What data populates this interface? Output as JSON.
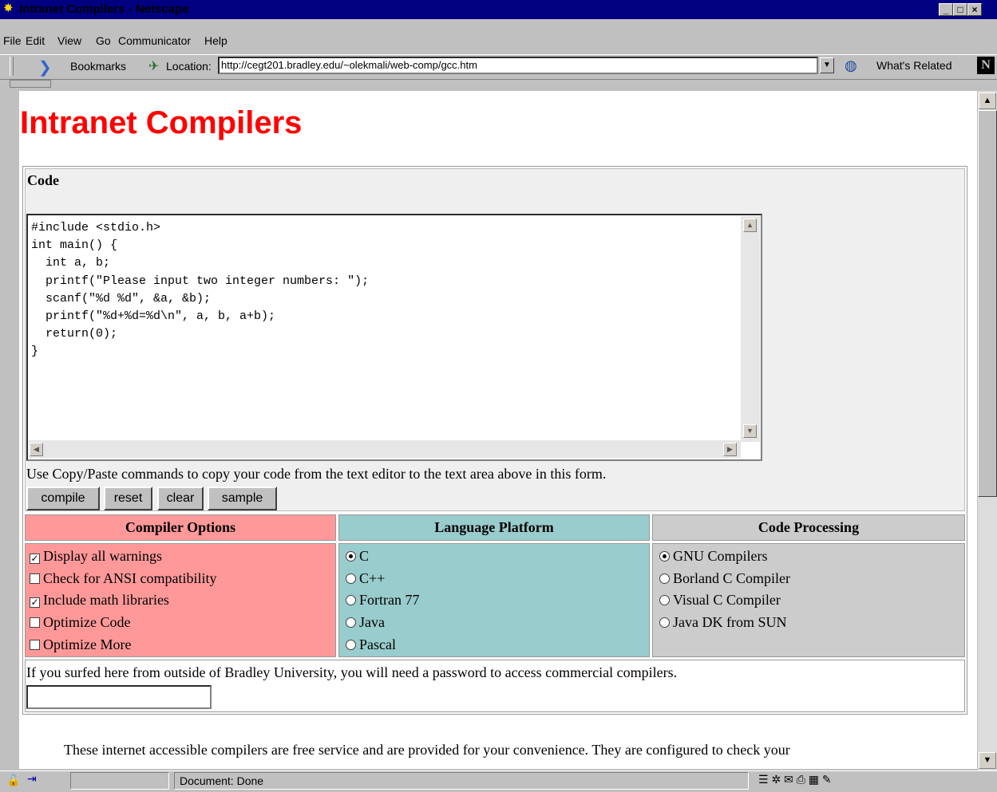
{
  "window": {
    "title": "Intranet Compilers - Netscape",
    "icon": "netscape-star-icon"
  },
  "menu": [
    "File",
    "Edit",
    "View",
    "Go",
    "Communicator",
    "Help"
  ],
  "toolbar": {
    "bookmarks": "Bookmarks",
    "location_label": "Location:",
    "url": "http://cegt201.bradley.edu/~olekmali/web-comp/gcc.htm",
    "related": "What's Related"
  },
  "page": {
    "heading": "Intranet Compilers",
    "code_label": "Code",
    "code": "#include <stdio.h>\nint main() {\n  int a, b;\n  printf(\"Please input two integer numbers: \");\n  scanf(\"%d %d\", &a, &b);\n  printf(\"%d+%d=%d\\n\", a, b, a+b);\n  return(0);\n}",
    "code_help": "Use Copy/Paste commands to copy your code from the text editor to the text area above in this form.",
    "buttons": {
      "compile": "compile",
      "reset": "reset",
      "clear": "clear",
      "sample": "sample"
    },
    "compiler_options": {
      "header": "Compiler Options",
      "color": "#ff9999",
      "items": [
        {
          "label": "Display all warnings",
          "checked": true
        },
        {
          "label": "Check for ANSI compatibility",
          "checked": false
        },
        {
          "label": "Include math libraries",
          "checked": true
        },
        {
          "label": "Optimize Code",
          "checked": false
        },
        {
          "label": "Optimize More",
          "checked": false
        }
      ]
    },
    "language_platform": {
      "header": "Language Platform",
      "color": "#99cccc",
      "items": [
        {
          "label": "C",
          "selected": true
        },
        {
          "label": "C++",
          "selected": false
        },
        {
          "label": "Fortran 77",
          "selected": false
        },
        {
          "label": "Java",
          "selected": false
        },
        {
          "label": "Pascal",
          "selected": false
        }
      ]
    },
    "code_processing": {
      "header": "Code Processing",
      "color": "#cccccc",
      "items": [
        {
          "label": "GNU Compilers",
          "selected": true
        },
        {
          "label": "Borland C Compiler",
          "selected": false
        },
        {
          "label": "Visual C Compiler",
          "selected": false
        },
        {
          "label": "Java DK from SUN",
          "selected": false
        }
      ]
    },
    "password_note": "If you surfed here from outside of Bradley University, you will need a password to access commercial compilers.",
    "disclaimer": "These internet accessible compilers are free service and are provided for your convenience. They are configured to check your"
  },
  "status": {
    "text": "Document: Done"
  }
}
